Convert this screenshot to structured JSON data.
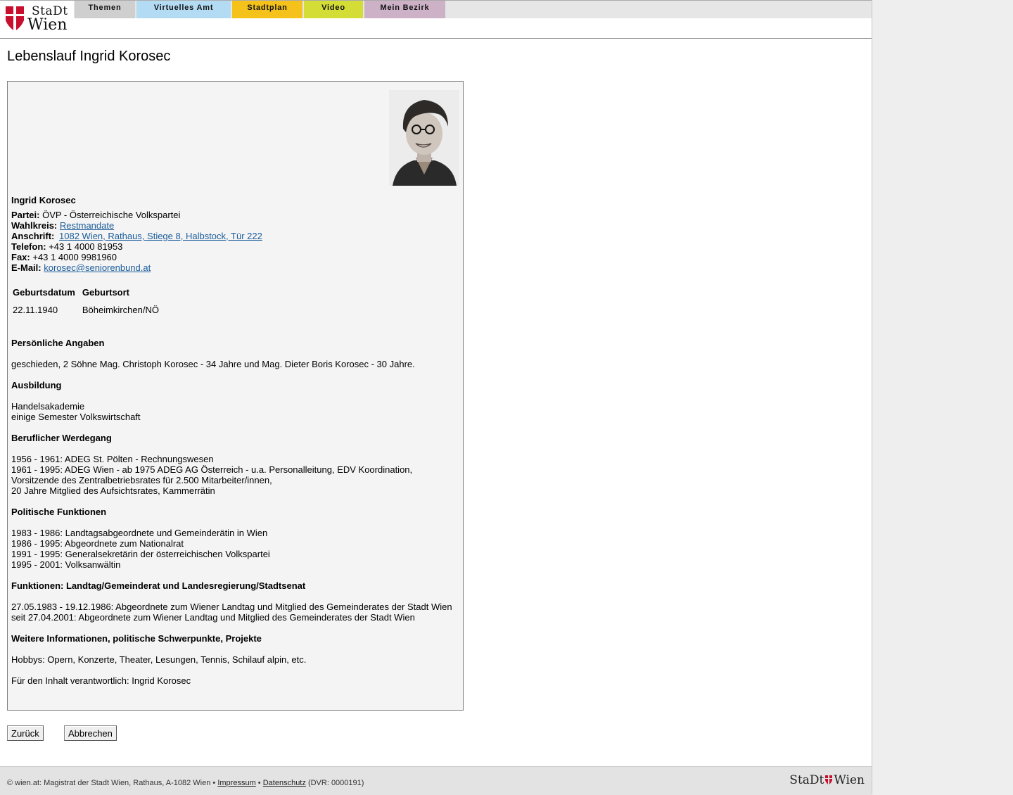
{
  "header": {
    "logo": {
      "stadt": "StaDt",
      "wien": "Wien"
    },
    "nav": [
      {
        "label": "Themen",
        "color": "#cfcfcf"
      },
      {
        "label": "Virtuelles Amt",
        "color": "#b3dcf4"
      },
      {
        "label": "Stadtplan",
        "color": "#f4c21a"
      },
      {
        "label": "Video",
        "color": "#d4dc36"
      },
      {
        "label": "Mein Bezirk",
        "color": "#cdb1c6"
      }
    ]
  },
  "page_title": "Lebenslauf Ingrid Korosec",
  "profile": {
    "name": "Ingrid Korosec",
    "partei_label": "Partei:",
    "partei": "ÖVP - Österreichische Volkspartei",
    "wahlkreis_label": "Wahlkreis:",
    "wahlkreis": "Restmandate",
    "anschrift_label": "Anschrift:",
    "anschrift": "1082 Wien, Rathaus, Stiege 8, Halbstock, Tür 222",
    "telefon_label": "Telefon:",
    "telefon": "+43 1 4000 81953",
    "fax_label": "Fax:",
    "fax": "+43 1 4000 9981960",
    "email_label": "E-Mail:",
    "email": "korosec@seniorenbund.at"
  },
  "birth_table": {
    "headers": [
      "Geburtsdatum",
      "Geburtsort"
    ],
    "row": [
      "22.11.1940",
      "Böheimkirchen/NÖ"
    ]
  },
  "sections": [
    {
      "title": "Persönliche Angaben",
      "lines": [
        "geschieden, 2 Söhne Mag. Christoph Korosec - 34 Jahre und Mag. Dieter Boris Korosec - 30 Jahre."
      ]
    },
    {
      "title": "Ausbildung",
      "lines": [
        "Handelsakademie",
        "einige Semester Volkswirtschaft"
      ]
    },
    {
      "title": "Beruflicher Werdegang",
      "lines": [
        "1956 - 1961: ADEG St. Pölten - Rechnungswesen",
        "1961 - 1995: ADEG Wien - ab 1975 ADEG AG Österreich - u.a. Personalleitung, EDV Koordination,",
        "Vorsitzende des Zentralbetriebsrates für 2.500 Mitarbeiter/innen,",
        "20 Jahre Mitglied des Aufsichtsrates, Kammerrätin"
      ]
    },
    {
      "title": "Politische Funktionen",
      "lines": [
        "1983 - 1986: Landtagsabgeordnete und Gemeinderätin in Wien",
        "1986 - 1995: Abgeordnete zum Nationalrat",
        "1991 - 1995: Generalsekretärin der österreichischen Volkspartei",
        "1995 - 2001: Volksanwältin"
      ]
    },
    {
      "title": "Funktionen: Landtag/Gemeinderat und Landesregierung/Stadtsenat",
      "lines": [
        "27.05.1983 - 19.12.1986: Abgeordnete zum Wiener Landtag und Mitglied des Gemeinderates der Stadt Wien",
        "seit 27.04.2001: Abgeordnete zum Wiener Landtag und Mitglied des Gemeinderates der Stadt Wien"
      ]
    },
    {
      "title": "Weitere Informationen, politische Schwerpunkte, Projekte",
      "lines": [
        "Hobbys: Opern, Konzerte, Theater, Lesungen, Tennis, Schilauf alpin, etc."
      ]
    }
  ],
  "responsible": "Für den Inhalt verantwortlich: Ingrid Korosec",
  "buttons": {
    "back": "Zurück",
    "cancel": "Abbrechen"
  },
  "footer": {
    "copyright": "© wien.at: Magistrat der Stadt Wien, Rathaus, A-1082 Wien •",
    "impressum": "Impressum",
    "sep": "•",
    "datenschutz": "Datenschutz",
    "dvr": "(DVR: 0000191)",
    "logo_left": "StaDt",
    "logo_right": "Wien"
  },
  "colors": {
    "flag_red": "#c8102e",
    "link": "#1a5c9a"
  }
}
